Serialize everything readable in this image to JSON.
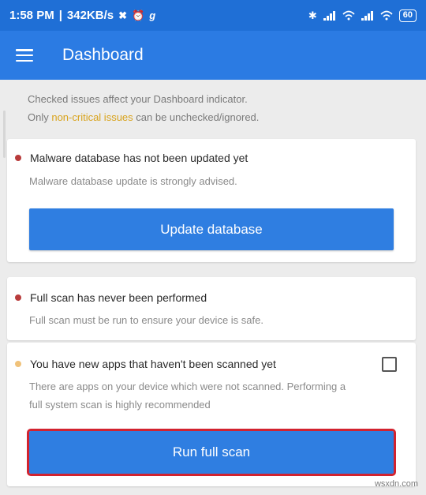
{
  "status_bar": {
    "time": "1:58 PM",
    "speed": "342KB/s",
    "battery": "60"
  },
  "app_bar": {
    "title": "Dashboard"
  },
  "intro": {
    "line1": "Checked issues affect your Dashboard indicator.",
    "line2_prefix": "Only ",
    "line2_highlight": "non-critical issues",
    "line2_suffix": " can be unchecked/ignored."
  },
  "issues": [
    {
      "title": "Malware database has not been updated yet",
      "description": "Malware database update is strongly advised.",
      "severity": "critical",
      "button": "Update database"
    },
    {
      "title": "Full scan has never been performed",
      "description": "Full scan must be run to ensure your device is safe.",
      "severity": "critical"
    },
    {
      "title": "You have new apps that haven't been scanned yet",
      "description_line1": "There are apps on your device which were not scanned. Performing a",
      "description_line2": "full system scan is highly recommended",
      "severity": "non-critical",
      "checked": false,
      "button": "Run full scan"
    }
  ],
  "colors": {
    "status_bar": "#1f6fd6",
    "app_bar": "#2b7be3",
    "button": "#2f7ee1",
    "critical_dot": "#b83b3b",
    "non_critical_dot": "#f0c27a",
    "highlight_text": "#d9a31c",
    "annotation_outline": "#d2232f"
  },
  "watermark": "wsxdn.com"
}
